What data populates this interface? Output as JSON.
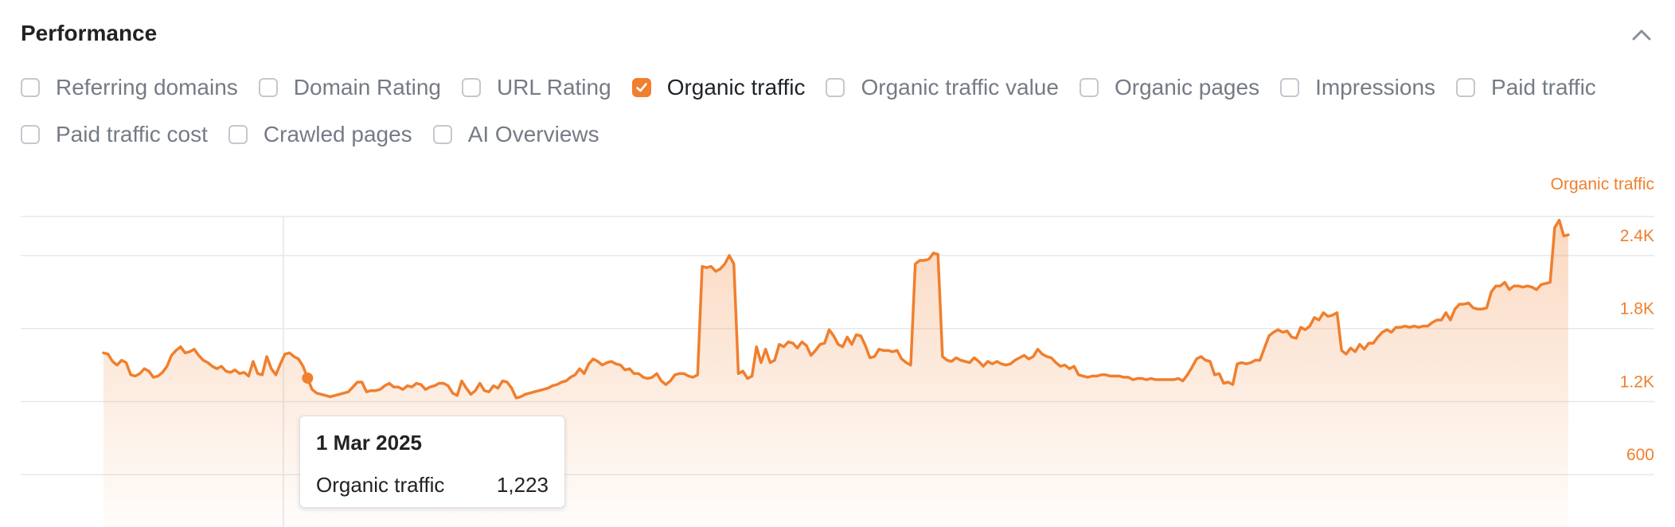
{
  "panel": {
    "title": "Performance"
  },
  "icons": {
    "collapse": "chevron-up-icon",
    "check": "checkmark-icon"
  },
  "colors": {
    "accent": "#f07f2e",
    "grid": "#e6e8eb"
  },
  "metrics": [
    {
      "label": "Referring domains",
      "checked": false
    },
    {
      "label": "Domain Rating",
      "checked": false
    },
    {
      "label": "URL Rating",
      "checked": false
    },
    {
      "label": "Organic traffic",
      "checked": true
    },
    {
      "label": "Organic traffic value",
      "checked": false
    },
    {
      "label": "Organic pages",
      "checked": false
    },
    {
      "label": "Impressions",
      "checked": false
    },
    {
      "label": "Paid traffic",
      "checked": false
    },
    {
      "label": "Paid traffic cost",
      "checked": false
    },
    {
      "label": "Crawled pages",
      "checked": false
    },
    {
      "label": "AI Overviews",
      "checked": false
    }
  ],
  "chart_data": {
    "type": "area",
    "series": [
      {
        "name": "Organic traffic",
        "values": [
          1430,
          1420,
          1360,
          1330,
          1370,
          1350,
          1250,
          1240,
          1260,
          1300,
          1280,
          1230,
          1240,
          1270,
          1320,
          1410,
          1450,
          1480,
          1430,
          1440,
          1460,
          1410,
          1370,
          1350,
          1320,
          1300,
          1320,
          1280,
          1270,
          1290,
          1260,
          1270,
          1240,
          1360,
          1260,
          1250,
          1400,
          1300,
          1250,
          1340,
          1420,
          1430,
          1400,
          1380,
          1320,
          1223,
          1130,
          1100,
          1090,
          1080,
          1070,
          1080,
          1090,
          1100,
          1110,
          1150,
          1190,
          1190,
          1110,
          1120,
          1120,
          1130,
          1160,
          1180,
          1150,
          1150,
          1130,
          1160,
          1150,
          1180,
          1170,
          1130,
          1150,
          1160,
          1180,
          1180,
          1160,
          1100,
          1080,
          1200,
          1140,
          1090,
          1120,
          1180,
          1120,
          1110,
          1160,
          1140,
          1200,
          1190,
          1140,
          1060,
          1070,
          1090,
          1100,
          1110,
          1120,
          1130,
          1140,
          1160,
          1170,
          1190,
          1200,
          1230,
          1250,
          1300,
          1260,
          1340,
          1380,
          1360,
          1330,
          1350,
          1360,
          1340,
          1330,
          1290,
          1300,
          1260,
          1260,
          1230,
          1220,
          1230,
          1260,
          1200,
          1170,
          1200,
          1250,
          1260,
          1260,
          1240,
          1230,
          1250,
          2140,
          2130,
          2140,
          2100,
          2120,
          2160,
          2230,
          2160,
          1260,
          1280,
          1220,
          1240,
          1480,
          1350,
          1460,
          1350,
          1370,
          1500,
          1480,
          1520,
          1510,
          1470,
          1520,
          1490,
          1410,
          1450,
          1500,
          1510,
          1620,
          1570,
          1500,
          1480,
          1560,
          1500,
          1580,
          1570,
          1490,
          1390,
          1400,
          1460,
          1450,
          1450,
          1440,
          1450,
          1380,
          1350,
          1330,
          2160,
          2190,
          2190,
          2200,
          2250,
          2240,
          1400,
          1370,
          1360,
          1390,
          1370,
          1360,
          1350,
          1390,
          1360,
          1320,
          1360,
          1340,
          1360,
          1340,
          1330,
          1340,
          1370,
          1390,
          1410,
          1380,
          1400,
          1460,
          1420,
          1400,
          1390,
          1350,
          1320,
          1330,
          1300,
          1320,
          1250,
          1240,
          1230,
          1240,
          1240,
          1250,
          1250,
          1240,
          1240,
          1240,
          1230,
          1230,
          1210,
          1220,
          1220,
          1210,
          1220,
          1210,
          1210,
          1210,
          1210,
          1210,
          1220,
          1200,
          1250,
          1310,
          1380,
          1400,
          1370,
          1360,
          1250,
          1260,
          1180,
          1190,
          1170,
          1340,
          1350,
          1340,
          1350,
          1370,
          1370,
          1470,
          1570,
          1600,
          1620,
          1600,
          1610,
          1560,
          1550,
          1640,
          1620,
          1650,
          1720,
          1700,
          1760,
          1730,
          1740,
          1760,
          1450,
          1420,
          1470,
          1440,
          1500,
          1460,
          1510,
          1510,
          1560,
          1600,
          1620,
          1600,
          1640,
          1640,
          1650,
          1640,
          1650,
          1640,
          1650,
          1650,
          1680,
          1700,
          1700,
          1760,
          1700,
          1790,
          1830,
          1830,
          1840,
          1800,
          1790,
          1790,
          1800,
          1930,
          1980,
          1980,
          2010,
          1950,
          1980,
          1980,
          1970,
          1980,
          1970,
          1950,
          1990,
          2000,
          2010,
          2460,
          2520,
          2390,
          2400
        ]
      }
    ],
    "highlight": {
      "date": "1 Mar 2025",
      "value": 1223,
      "value_label": "1,223",
      "index": 45
    },
    "y_axis": {
      "title": "Organic traffic",
      "ticks": [
        600,
        1200,
        1800,
        2400
      ],
      "tick_labels": [
        "600",
        "1.2K",
        "1.8K",
        "2.4K"
      ],
      "position": "right"
    },
    "ylim": [
      0,
      2550
    ],
    "grid": true
  },
  "tooltip": {
    "date": "1 Mar 2025",
    "metric": "Organic traffic",
    "value": "1,223"
  }
}
